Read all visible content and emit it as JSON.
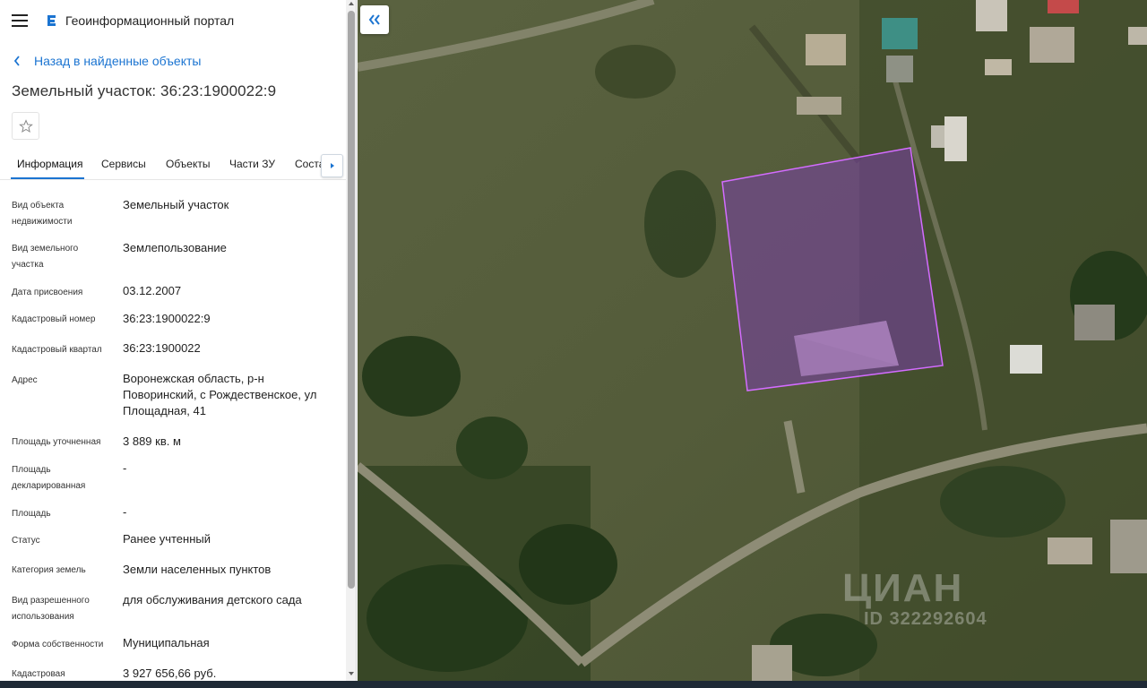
{
  "app": {
    "title": "Геоинформационный портал"
  },
  "nav": {
    "back_label": "Назад в найденные объекты"
  },
  "object": {
    "title": "Земельный участок: 36:23:1900022:9"
  },
  "tabs": [
    {
      "label": "Информация",
      "active": true
    },
    {
      "label": "Сервисы"
    },
    {
      "label": "Объекты"
    },
    {
      "label": "Части ЗУ"
    },
    {
      "label": "Соста"
    }
  ],
  "info": {
    "vid_obekta": {
      "label1": "Вид объекта",
      "label2": "недвижимости",
      "value": "Земельный участок"
    },
    "vid_uchastka": {
      "label1": "Вид земельного",
      "label2": "участка",
      "value": "Землепользование"
    },
    "data": {
      "label": "Дата присвоения",
      "value": "03.12.2007"
    },
    "kad_nomer": {
      "label": "Кадастровый номер",
      "value": "36:23:1900022:9"
    },
    "kad_kvartal": {
      "label": "Кадастровый квартал",
      "value": "36:23:1900022"
    },
    "adres": {
      "label": "Адрес",
      "line1": "Воронежская область, р-н",
      "line2": "Поворинский, с Рождественское, ул",
      "line3": "Площадная, 41"
    },
    "ploshad_utoch": {
      "label": "Площадь уточненная",
      "value": "3 889 кв. м"
    },
    "ploshad_dekl": {
      "label1": "Площадь",
      "label2": "декларированная",
      "value": "-"
    },
    "ploshad": {
      "label": "Площадь",
      "value": "-"
    },
    "status": {
      "label": "Статус",
      "value": "Ранее учтенный"
    },
    "kategoriya": {
      "label": "Категория земель",
      "value": "Земли населенных пунктов"
    },
    "vid_razresh": {
      "label1": "Вид разрешенного",
      "label2": "использования",
      "value": "для обслуживания детского сада"
    },
    "forma": {
      "label": "Форма собственности",
      "value": "Муниципальная"
    },
    "kad_stoimost": {
      "label": "Кадастровая",
      "value": "3 927 656,66 руб."
    }
  },
  "watermark": {
    "logo": "ЦИАН",
    "id": "ID 322292604"
  },
  "colors": {
    "accent": "#1b74d1",
    "parcel_fill": "#7a3fa8",
    "parcel_stroke": "#d36cff"
  }
}
